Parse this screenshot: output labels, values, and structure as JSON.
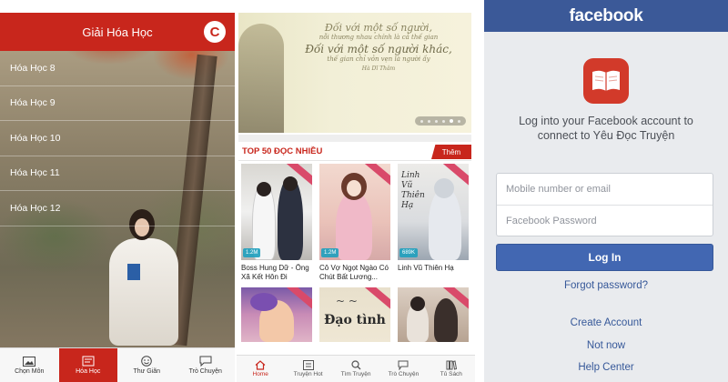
{
  "chemistry_app": {
    "title": "Giải Hóa Học",
    "logo_text": "C",
    "menu": [
      "Hóa Học 8",
      "Hóa Học 9",
      "Hóa Học 10",
      "Hóa Học 11",
      "Hóa Học 12"
    ],
    "nav": [
      {
        "label": "Chọn Môn",
        "icon": "image-icon",
        "active": false
      },
      {
        "label": "Hóa Học",
        "icon": "book-icon",
        "active": true
      },
      {
        "label": "Thư Giãn",
        "icon": "smile-icon",
        "active": false
      },
      {
        "label": "Trò Chuyện",
        "icon": "chat-icon",
        "active": false
      }
    ],
    "accent": "#c8261c"
  },
  "story_app": {
    "banner": {
      "line1": "Đối với một số người,",
      "line2": "nỗi thương nhau chính là cả thế gian",
      "line3": "Đối với một số người khác,",
      "line4": "thế gian chỉ vỏn vẹn là người ấy",
      "line5": "Hà Dĩ Thâm",
      "slide_count": 6,
      "active_slide": 4
    },
    "section_title": "TOP 50 ĐỌC NHIỀU",
    "more_label": "Thêm",
    "books": [
      {
        "title": "Boss Hung Dữ - Ông Xã Kết Hôn Đi",
        "views": "1.2M"
      },
      {
        "title": "Cô Vợ Ngọt Ngào Có Chút Bất Lương...",
        "views": "1.2M"
      },
      {
        "title": "Linh Vũ Thiên Hạ",
        "views": "689K"
      },
      {
        "title": "",
        "views": ""
      },
      {
        "title": "",
        "views": ""
      },
      {
        "title": "",
        "views": ""
      }
    ],
    "cover_text": {
      "book3": "Linh Vũ Thiên Hạ",
      "book5": "Đạo tình"
    },
    "nav": [
      {
        "label": "Home",
        "icon": "home-icon",
        "active": true
      },
      {
        "label": "Truyện Hot",
        "icon": "hot-list-icon",
        "active": false
      },
      {
        "label": "Tìm Truyện",
        "icon": "search-icon",
        "active": false
      },
      {
        "label": "Trò Chuyện",
        "icon": "chat-icon",
        "active": false
      },
      {
        "label": "Tủ Sách",
        "icon": "bookshelf-icon",
        "active": false
      }
    ],
    "accent": "#c8261c"
  },
  "facebook_login": {
    "brand": "facebook",
    "app_icon": "open-book-icon",
    "message": "Log into your Facebook account to connect to Yêu Đọc Truyện",
    "phone_placeholder": "Mobile number or email",
    "password_placeholder": "Facebook Password",
    "login_label": "Log In",
    "forgot_label": "Forgot password?",
    "create_label": "Create Account",
    "not_now_label": "Not now",
    "help_label": "Help Center",
    "brand_color": "#3b5998",
    "button_color": "#4267b2"
  }
}
